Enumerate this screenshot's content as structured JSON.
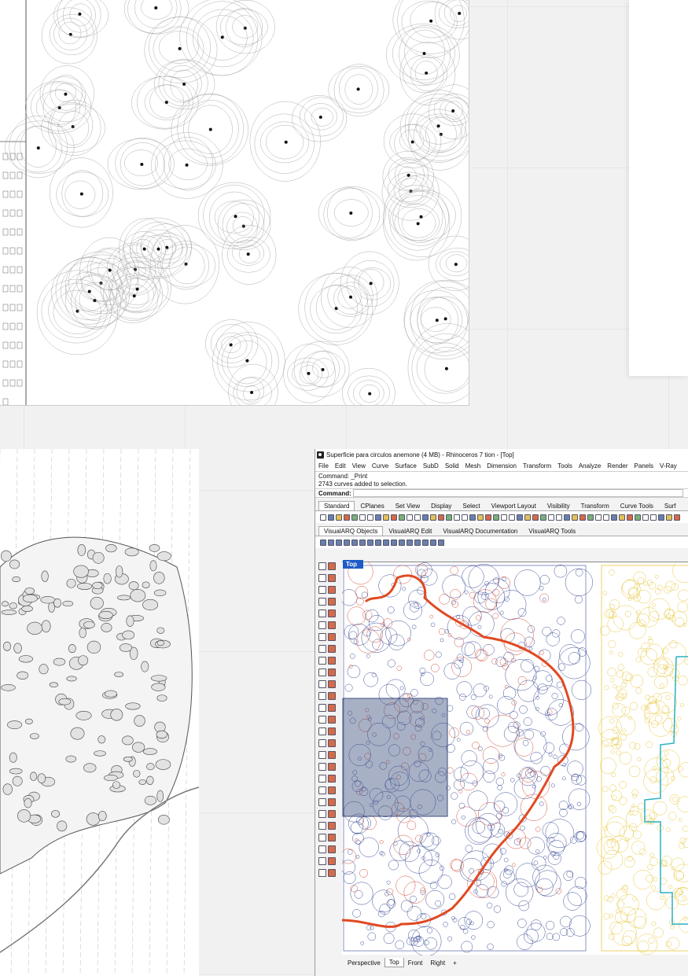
{
  "rhino": {
    "title": "Superficie para circulos anemone (4 MB) - Rhinoceros 7 tion - [Top]",
    "menu": [
      "File",
      "Edit",
      "View",
      "Curve",
      "Surface",
      "SubD",
      "Solid",
      "Mesh",
      "Dimension",
      "Transform",
      "Tools",
      "Analyze",
      "Render",
      "Panels",
      "V-Ray"
    ],
    "history": [
      "Command: _Print",
      "2743 curves added to selection."
    ],
    "command_label": "Command:",
    "command_value": "",
    "toolbar_tabs": [
      "Standard",
      "CPlanes",
      "Set View",
      "Display",
      "Select",
      "Viewport Layout",
      "Visibility",
      "Transform",
      "Curve Tools",
      "Surf"
    ],
    "plugin_tabs": [
      "VisualARQ Objects",
      "VisualARQ Edit",
      "VisualARQ Documentation",
      "VisualARQ Tools"
    ],
    "viewport_label": "Top",
    "viewport_tabs": [
      "Perspective",
      "Top",
      "Front",
      "Right"
    ],
    "add_tab_glyph": "+"
  },
  "colors": {
    "outline": "#e04a22",
    "circles_blue": "#3c4d96",
    "circles_red": "#d2503c",
    "circles_yellow": "#e8c840",
    "cyan": "#2ab0c0",
    "selection": "#3e4f7e",
    "active_view": "#1e5bc6"
  },
  "icons": [
    "rhino-logo-icon",
    "toolbar-icon",
    "sidebar-tool-icon",
    "add-viewport-icon"
  ]
}
